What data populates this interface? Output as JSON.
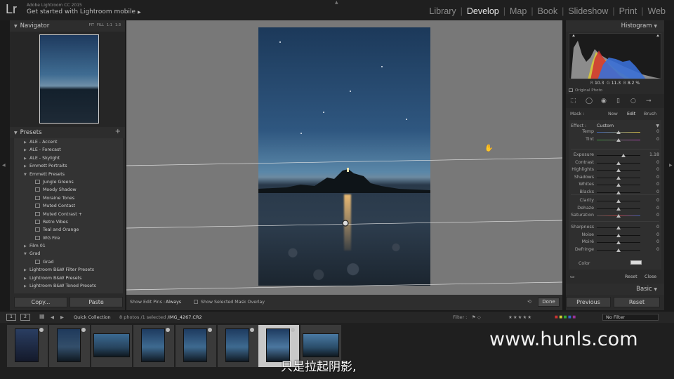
{
  "app": {
    "logo": "Lr",
    "name": "Adobe Lightroom CC 2015",
    "mobile_link": "Get started with Lightroom mobile"
  },
  "modules": [
    {
      "label": "Library",
      "active": false
    },
    {
      "label": "Develop",
      "active": true
    },
    {
      "label": "Map",
      "active": false
    },
    {
      "label": "Book",
      "active": false
    },
    {
      "label": "Slideshow",
      "active": false
    },
    {
      "label": "Print",
      "active": false
    },
    {
      "label": "Web",
      "active": false
    }
  ],
  "navigator": {
    "title": "Navigator",
    "zoom_options": [
      "FIT",
      "FILL",
      "1:1",
      "1:3"
    ]
  },
  "presets": {
    "title": "Presets",
    "items": [
      {
        "label": "ALE - Accent",
        "level": 0,
        "tri": "▶"
      },
      {
        "label": "ALE - Forecast",
        "level": 0,
        "tri": "▶"
      },
      {
        "label": "ALE - Skylight",
        "level": 0,
        "tri": "▶"
      },
      {
        "label": "Emmett Portraits",
        "level": 0,
        "tri": "▶"
      },
      {
        "label": "Emmett Presets",
        "level": 0,
        "tri": "▼"
      },
      {
        "label": "Jungle Greens",
        "level": 1
      },
      {
        "label": "Moody Shadow",
        "level": 1
      },
      {
        "label": "Moraine Tones",
        "level": 1
      },
      {
        "label": "Muted Contast",
        "level": 1
      },
      {
        "label": "Muted Contrast +",
        "level": 1
      },
      {
        "label": "Retro Vibes",
        "level": 1
      },
      {
        "label": "Teal and Orange",
        "level": 1
      },
      {
        "label": "WG Fire",
        "level": 1
      },
      {
        "label": "Film 01",
        "level": 0,
        "tri": "▶"
      },
      {
        "label": "Grad",
        "level": 0,
        "tri": "▼"
      },
      {
        "label": "Grad",
        "level": 1
      },
      {
        "label": "Lightroom B&W Filter Presets",
        "level": 0,
        "tri": "▶"
      },
      {
        "label": "Lightroom B&W Presets",
        "level": 0,
        "tri": "▶"
      },
      {
        "label": "Lightroom B&W Toned Presets",
        "level": 0,
        "tri": "▶"
      }
    ]
  },
  "left_buttons": {
    "copy": "Copy...",
    "paste": "Paste"
  },
  "toolbar": {
    "edit_pins_label": "Show Edit Pins :",
    "edit_pins_value": "Always",
    "overlay_label": "Show Selected Mask Overlay",
    "done": "Done"
  },
  "histogram": {
    "title": "Histogram",
    "r_label": "R",
    "r_value": "10.3",
    "g_label": "G",
    "g_value": "11.3",
    "b_label": "B",
    "b_value": "8.2",
    "unit": "%",
    "original_photo": "Original Photo"
  },
  "mask": {
    "label": "Mask :",
    "new": "New",
    "edit": "Edit",
    "brush": "Brush"
  },
  "effect": {
    "label": "Effect :",
    "value": "Custom"
  },
  "sliders": [
    {
      "label": "Temp",
      "value": "0",
      "pos": 0.5,
      "group": 0
    },
    {
      "label": "Tint",
      "value": "0",
      "pos": 0.5,
      "group": 0
    },
    {
      "label": "Exposure",
      "value": "1.18",
      "pos": 0.62,
      "group": 1
    },
    {
      "label": "Contrast",
      "value": "0",
      "pos": 0.5,
      "group": 1
    },
    {
      "label": "Highlights",
      "value": "0",
      "pos": 0.5,
      "group": 1
    },
    {
      "label": "Shadows",
      "value": "0",
      "pos": 0.5,
      "group": 1
    },
    {
      "label": "Whites",
      "value": "0",
      "pos": 0.5,
      "group": 1
    },
    {
      "label": "Blacks",
      "value": "0",
      "pos": 0.5,
      "group": 1
    },
    {
      "label": "Clarity",
      "value": "0",
      "pos": 0.5,
      "group": 2
    },
    {
      "label": "Dehaze",
      "value": "0",
      "pos": 0.5,
      "group": 2
    },
    {
      "label": "Saturation",
      "value": "0",
      "pos": 0.5,
      "group": 2
    },
    {
      "label": "Sharpness",
      "value": "0",
      "pos": 0.5,
      "group": 3
    },
    {
      "label": "Noise",
      "value": "0",
      "pos": 0.5,
      "group": 3
    },
    {
      "label": "Moiré",
      "value": "0",
      "pos": 0.5,
      "group": 3
    },
    {
      "label": "Defringe",
      "value": "0",
      "pos": 0.5,
      "group": 3
    }
  ],
  "color_label": "Color",
  "panel_actions": {
    "reset": "Reset",
    "close": "Close"
  },
  "basic": {
    "title": "Basic"
  },
  "right_buttons": {
    "previous": "Previous",
    "reset": "Reset"
  },
  "filmstrip_bar": {
    "monitor1": "1",
    "monitor2": "2",
    "source": "Quick Collection",
    "count": "8 photos /1 selected /",
    "filename": "IMG_4267.CR2",
    "filter_label": "Filter :",
    "filter_value": "No Filter"
  },
  "watermark": "www.hunls.com",
  "subtitle": "只是拉起阴影,",
  "colors": {
    "accent_active": "#e6e6e6",
    "panel_bg": "#2a2a2a",
    "canvas_bg": "#787878",
    "selected_thumb": "#c8c8c8"
  }
}
